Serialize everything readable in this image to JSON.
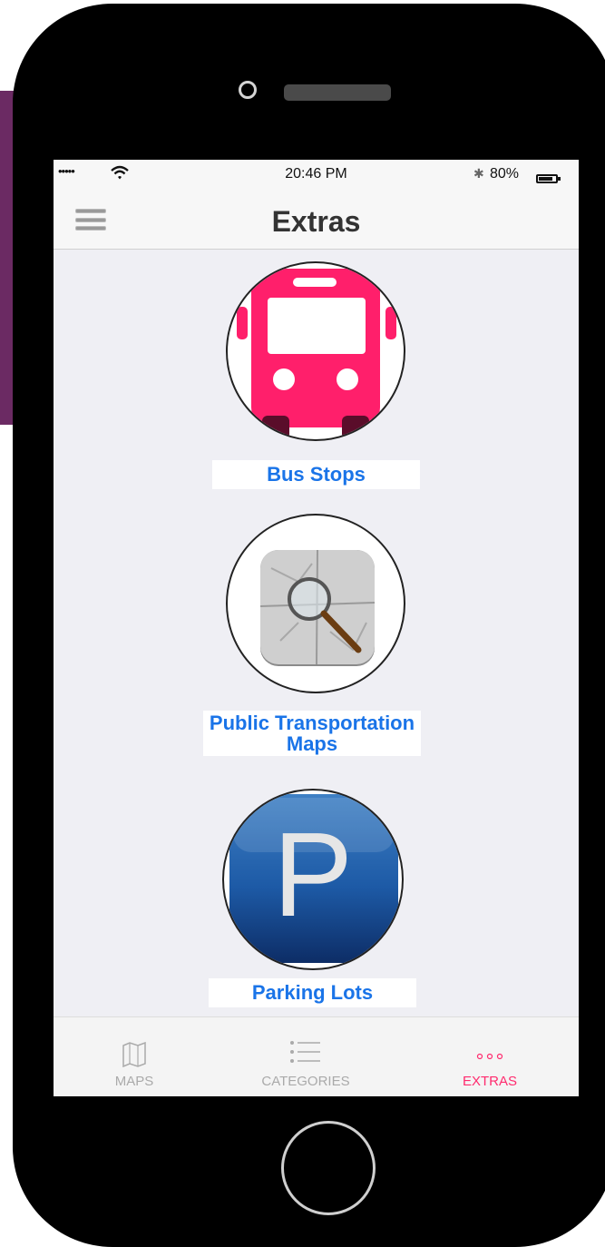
{
  "status_bar": {
    "signal": "•••••",
    "time": "20:46 PM",
    "battery_percent": "80%"
  },
  "nav": {
    "title": "Extras"
  },
  "features": [
    {
      "label": "Bus Stops",
      "icon": "bus-icon"
    },
    {
      "label_line1": "Public Transportation",
      "label_line2": "Maps",
      "icon": "map-magnifier-icon"
    },
    {
      "label": "Parking Lots",
      "icon": "parking-icon",
      "glyph": "P"
    }
  ],
  "tabs": [
    {
      "label": "MAPS",
      "icon": "map-icon",
      "active": false
    },
    {
      "label": "CATEGORIES",
      "icon": "list-icon",
      "active": false
    },
    {
      "label": "EXTRAS",
      "icon": "more-dots-icon",
      "active": true
    }
  ],
  "colors": {
    "accent": "#ff2b6e",
    "link_blue": "#1a74e8",
    "bus_pink": "#ff1f6b",
    "side_purple": "#6b2a63"
  }
}
